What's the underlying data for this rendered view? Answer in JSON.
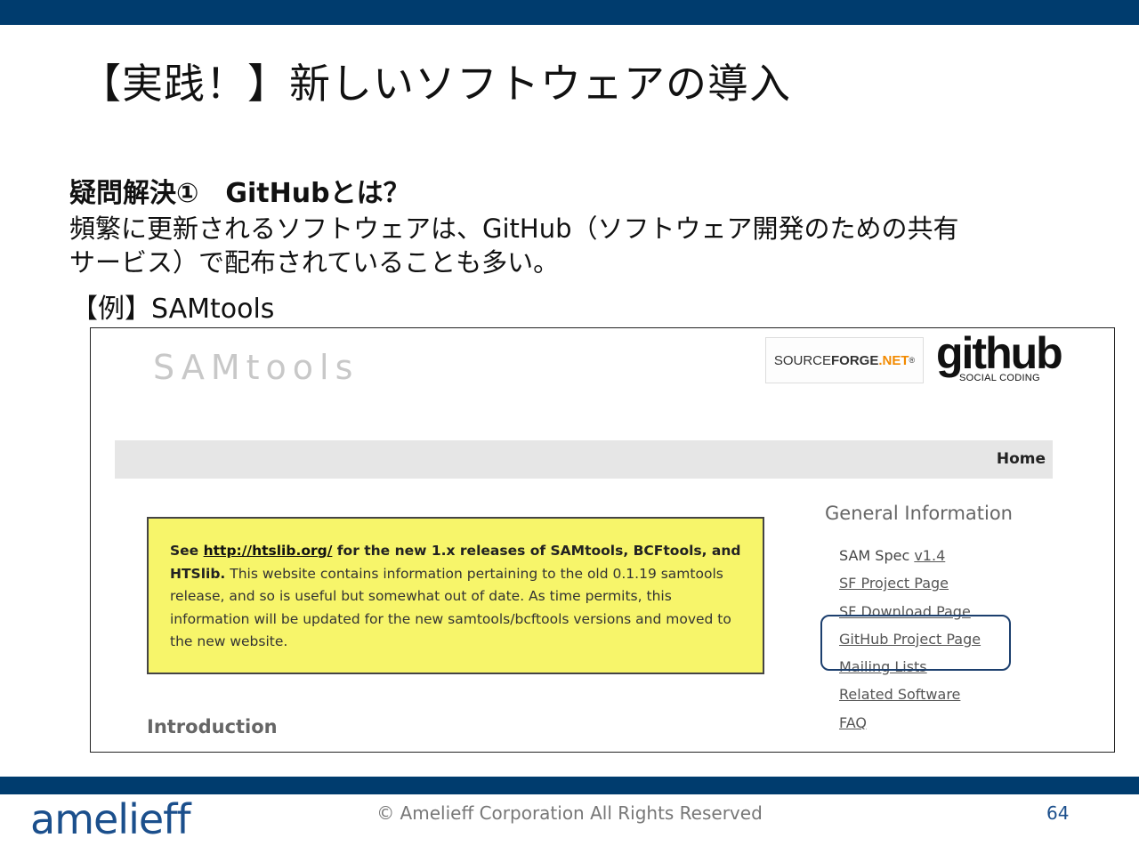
{
  "slide": {
    "title": "【実践！】新しいソフトウェアの導入",
    "section_heading": "疑問解決①　GitHubとは？",
    "body_line1": "頻繁に更新されるソフトウェアは、GitHub（ソフトウェア開発のための共有",
    "body_line2": "サービス）で配布されていることも多い。",
    "example_label": "【例】SAMtools"
  },
  "screenshot": {
    "logo_text": "SAMtools",
    "sourceforge": {
      "part1": "SOURCE",
      "part2": "FORGE",
      "part3": ".NET",
      "mark": "®"
    },
    "github": {
      "main": "github",
      "sub": "SOCIAL CODING"
    },
    "nav": {
      "home": "Home"
    },
    "notice": {
      "see": "See ",
      "link": "http://htslib.org/",
      "bold_rest": " for the new 1.x releases of SAMtools, BCFtools, and HTSlib.",
      "rest": " This website contains information pertaining to the old 0.1.19 samtools release, and so is useful but somewhat out of date. As time permits, this information will be updated for the new samtools/bcftools versions and moved to the new website."
    },
    "intro_heading": "Introduction",
    "sidebar": {
      "heading": "General Information",
      "sam_spec_label": "SAM Spec ",
      "sam_spec_version": "v1.4",
      "links": [
        "SF Project Page",
        "SF Download Page",
        "GitHub Project Page",
        "Mailing Lists",
        "Related Software",
        "FAQ"
      ]
    }
  },
  "footer": {
    "logo": "amelieff",
    "copyright": "© Amelieff Corporation All Rights Reserved",
    "page_number": "64"
  },
  "colors": {
    "brand_bar": "#003c6e",
    "notice_bg": "#f7f56a",
    "highlight_border": "#1c3f6e"
  }
}
